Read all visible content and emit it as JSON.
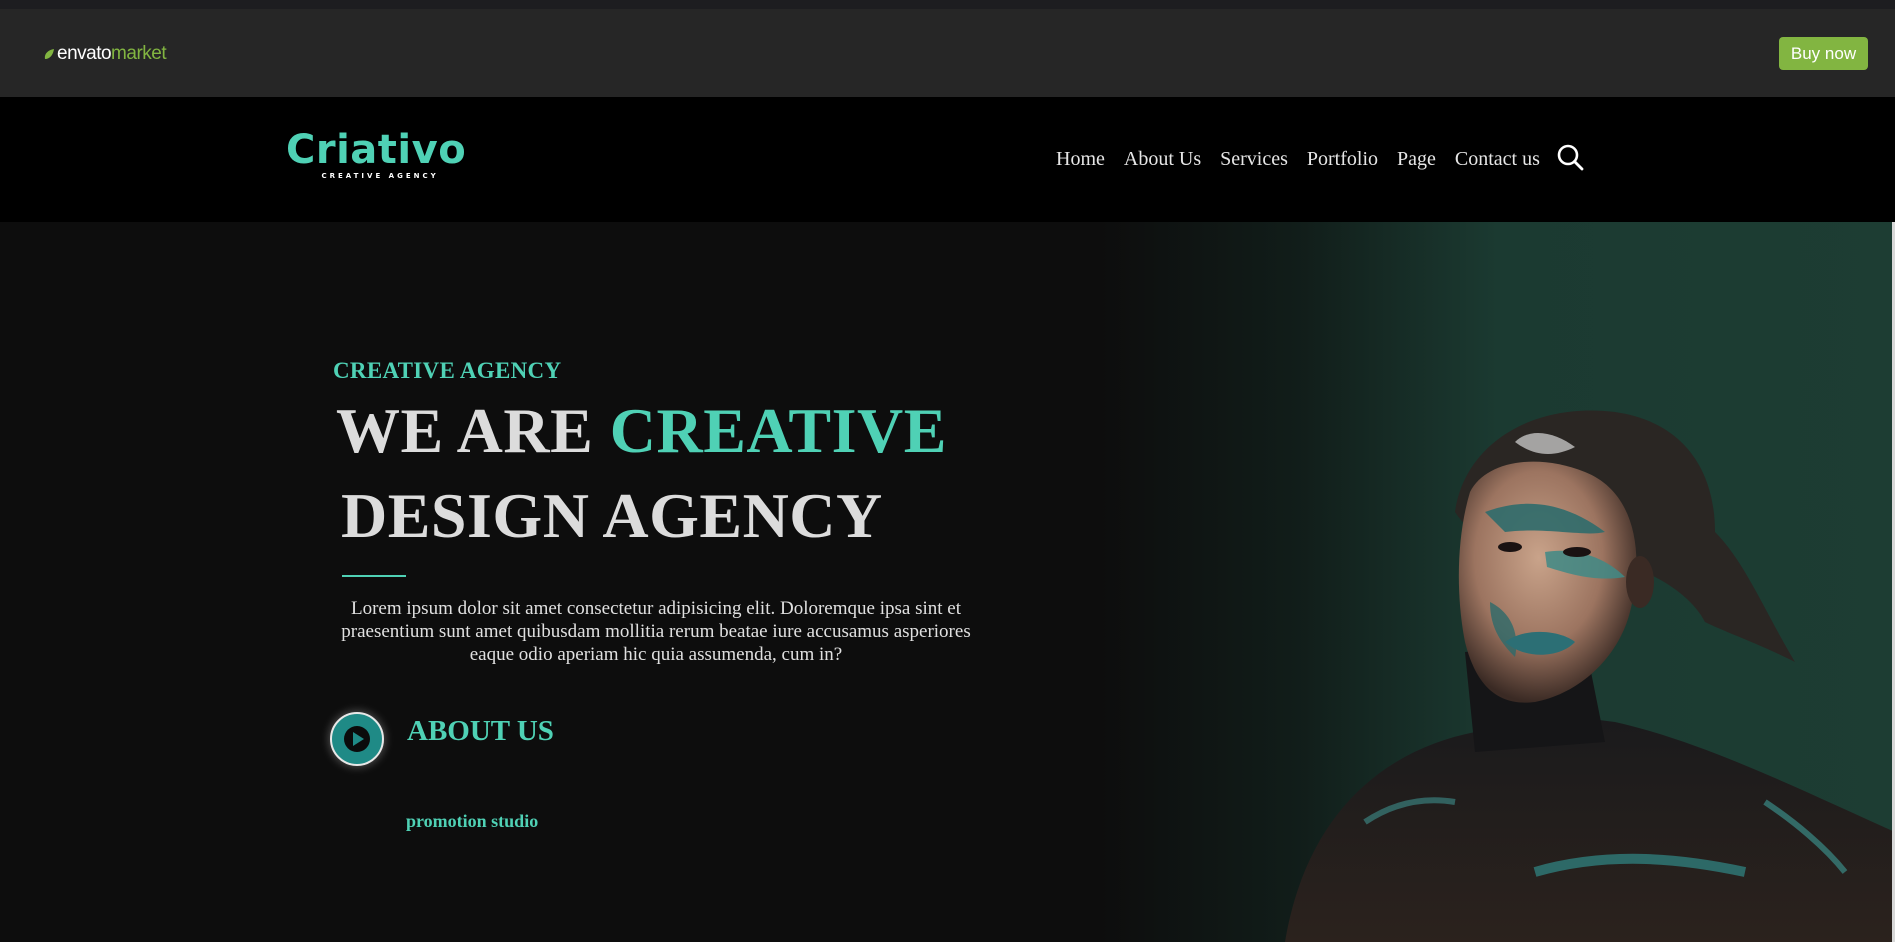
{
  "envato": {
    "logo_envato": "envato",
    "logo_market": "market",
    "buy_label": "Buy now"
  },
  "header": {
    "brand_name": "Criativo",
    "brand_tagline": "CREATIVE AGENCY",
    "nav": [
      "Home",
      "About Us",
      "Services",
      "Portfolio",
      "Page",
      "Contact us"
    ]
  },
  "hero": {
    "eyebrow": "CREATIVE AGENCY",
    "headline_part1": "WE ARE ",
    "headline_accent": "CREATIVE",
    "headline_line2": "DESIGN AGENCY",
    "lead": "Lorem ipsum dolor sit amet consectetur adipisicing elit. Doloremque ipsa sint et praesentium sunt amet quibusdam mollitia rerum beatae iure accusamus asperiores eaque odio aperiam hic quia assumenda, cum in?",
    "about_label": "ABOUT US",
    "promo_label": "promotion studio"
  },
  "colors": {
    "accent": "#4fd1b5",
    "envato_green": "#82b541",
    "header_bg": "#000000",
    "hero_bg": "#0d0d0d"
  },
  "icons": [
    "envato-leaf-icon",
    "search-icon",
    "play-icon"
  ]
}
